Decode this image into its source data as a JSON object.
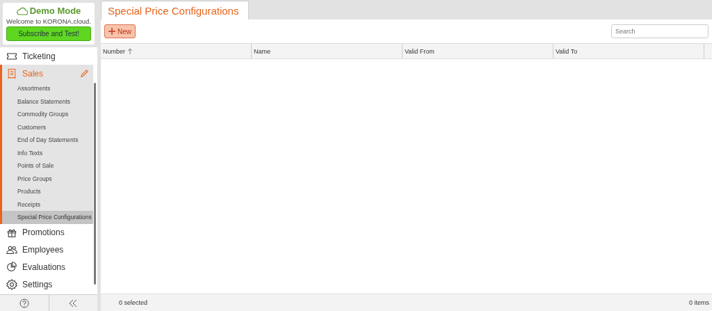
{
  "demo_card": {
    "title": "Demo Mode",
    "subtitle": "Welcome to KORONA.cloud.",
    "button": "Subscribe and Test!"
  },
  "sidebar": {
    "items": [
      {
        "label": "Ticketing",
        "selected": false
      },
      {
        "label": "Sales",
        "selected": true,
        "children": [
          {
            "label": "Assortments",
            "selected": false
          },
          {
            "label": "Balance Statements",
            "selected": false
          },
          {
            "label": "Commodity Groups",
            "selected": false
          },
          {
            "label": "Customers",
            "selected": false
          },
          {
            "label": "End of Day Statements",
            "selected": false
          },
          {
            "label": "Info Texts",
            "selected": false
          },
          {
            "label": "Points of Sale",
            "selected": false
          },
          {
            "label": "Price Groups",
            "selected": false
          },
          {
            "label": "Products",
            "selected": false
          },
          {
            "label": "Receipts",
            "selected": false
          },
          {
            "label": "Special Price Configurations",
            "selected": true
          }
        ]
      },
      {
        "label": "Promotions",
        "selected": false
      },
      {
        "label": "Employees",
        "selected": false
      },
      {
        "label": "Evaluations",
        "selected": false
      },
      {
        "label": "Settings",
        "selected": false
      }
    ]
  },
  "tabs": [
    {
      "label": "Special Price Configurations",
      "selected": true
    }
  ],
  "toolbar": {
    "new_button": "New",
    "search": {
      "placeholder": "Search"
    }
  },
  "table": {
    "columns": [
      {
        "label": "Number",
        "sorted": true
      },
      {
        "label": "Name",
        "sorted": false
      },
      {
        "label": "Valid From",
        "sorted": false
      },
      {
        "label": "Valid To",
        "sorted": false
      }
    ]
  },
  "status_bar": {
    "selected": "0 selected",
    "items": "0 items"
  }
}
